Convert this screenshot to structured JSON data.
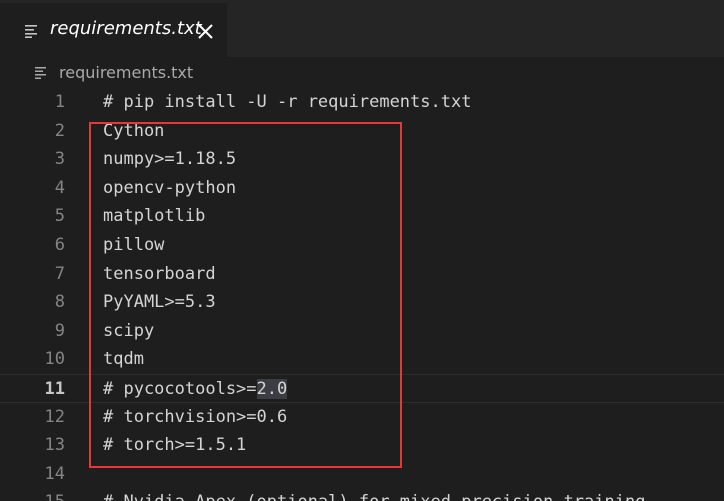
{
  "tab": {
    "title": "requirements.txt",
    "file_icon": "lines-file-icon",
    "close_icon": "close-icon"
  },
  "breadcrumb": {
    "label": "requirements.txt",
    "icon": "lines-file-icon"
  },
  "editor": {
    "current_line": 11,
    "lines": [
      {
        "num": "1",
        "text": "# pip install -U -r requirements.txt"
      },
      {
        "num": "2",
        "text": "Cython"
      },
      {
        "num": "3",
        "text": "numpy>=1.18.5"
      },
      {
        "num": "4",
        "text": "opencv-python"
      },
      {
        "num": "5",
        "text": "matplotlib"
      },
      {
        "num": "6",
        "text": "pillow"
      },
      {
        "num": "7",
        "text": "tensorboard"
      },
      {
        "num": "8",
        "text": "PyYAML>=5.3"
      },
      {
        "num": "9",
        "text": "scipy"
      },
      {
        "num": "10",
        "text": "tqdm"
      },
      {
        "num": "11",
        "text_before": "# pycocotools>=",
        "text_selected": "2.0",
        "text_after": ""
      },
      {
        "num": "12",
        "text": "# torchvision>=0.6"
      },
      {
        "num": "13",
        "text": "# torch>=1.5.1"
      },
      {
        "num": "14",
        "text": ""
      },
      {
        "num": "15",
        "text": "# Nvidia Apex (optional) for mixed precision training"
      }
    ]
  },
  "colors": {
    "background": "#1e1e1e",
    "tabbar": "#252526",
    "annotation_box": "#e03a3a",
    "selection": "#3a3d41"
  }
}
